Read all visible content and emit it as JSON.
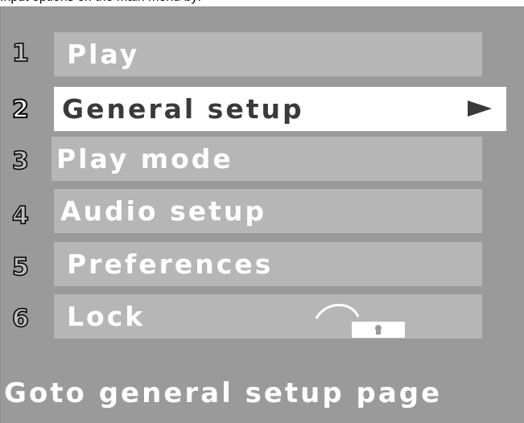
{
  "header": {
    "partial_text": "Input options on the main menu by:"
  },
  "menu": {
    "items": [
      {
        "number": "1",
        "label": "Play"
      },
      {
        "number": "2",
        "label": "General setup",
        "selected": true,
        "submenu_icon": "right-arrow-icon"
      },
      {
        "number": "3",
        "label": "Play mode"
      },
      {
        "number": "4",
        "label": "Audio setup"
      },
      {
        "number": "5",
        "label": "Preferences"
      },
      {
        "number": "6",
        "label": "Lock",
        "icon": "padlock-icon"
      }
    ]
  },
  "status": {
    "text": "Goto general setup page"
  },
  "colors": {
    "panel_background": "#9a9a9a",
    "item_background": "#b6b6b6",
    "selected_background": "#ffffff",
    "selected_text": "#3a3a3a",
    "item_text": "#ffffff"
  }
}
